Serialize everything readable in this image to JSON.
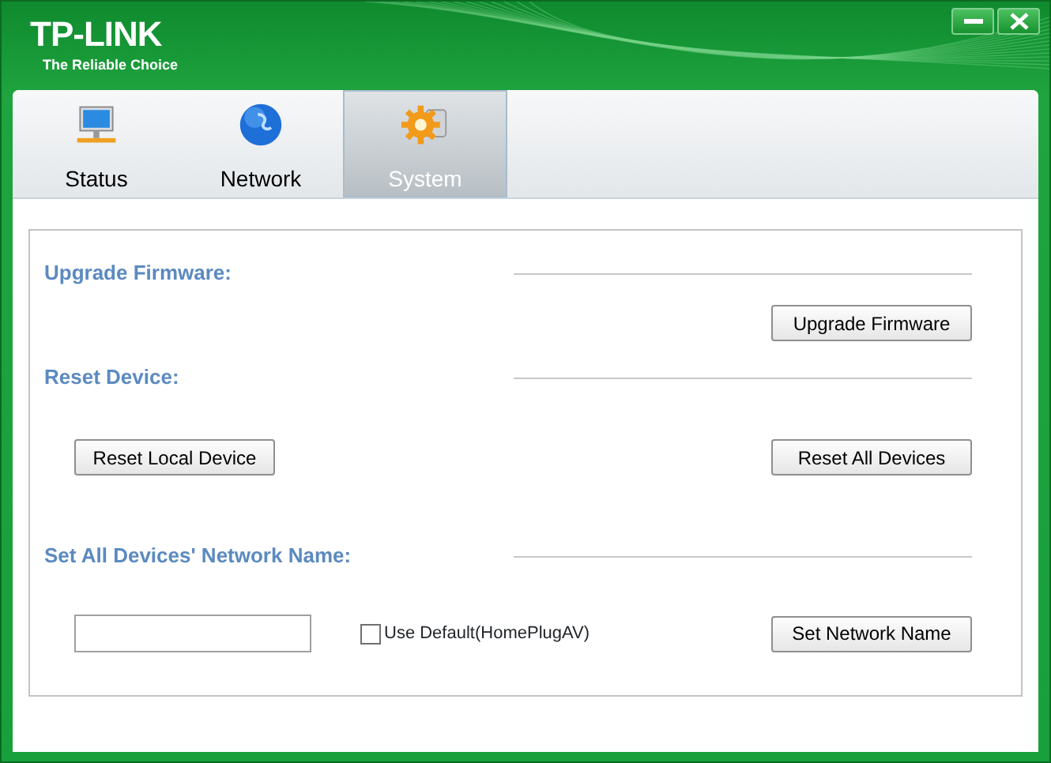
{
  "brand": {
    "logo": "TP-LINK",
    "tagline": "The Reliable Choice"
  },
  "tabs": [
    {
      "label": "Status",
      "selected": false
    },
    {
      "label": "Network",
      "selected": false
    },
    {
      "label": "System",
      "selected": true
    }
  ],
  "sections": [
    {
      "title": "Upgrade Firmware:",
      "controls": [
        {
          "kind": "button",
          "label": "Upgrade Firmware"
        }
      ]
    },
    {
      "title": "Reset Device:",
      "controls": [
        {
          "kind": "button",
          "label": "Reset Local Device"
        },
        {
          "kind": "button",
          "label": "Reset All Devices"
        }
      ]
    },
    {
      "title": "Set All Devices' Network Name:",
      "controls": [
        {
          "kind": "field"
        },
        {
          "kind": "checkbox",
          "label": "Use Default(HomePlugAV)",
          "checked": false
        },
        {
          "kind": "button",
          "label": "Set Network Name"
        }
      ]
    }
  ]
}
